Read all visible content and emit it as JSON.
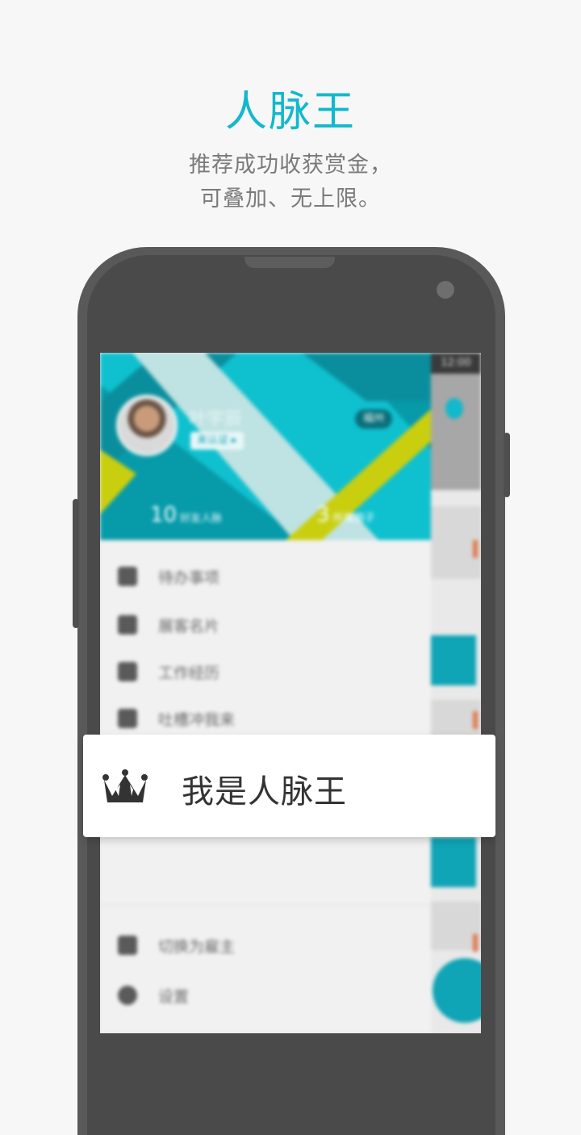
{
  "promo": {
    "title": "人脉王",
    "subtitle_line1": "推荐成功收获赏金，",
    "subtitle_line2": "可叠加、无上限。"
  },
  "app_screen": {
    "status_time": "12:00",
    "profile": {
      "name": "叶宇辰",
      "cert_label": "未认证 ▸",
      "location": "福州",
      "stat1_num": "10",
      "stat1_label": "好友人脉",
      "stat2_num": "3",
      "stat2_label": "所属圈子"
    },
    "menu": [
      {
        "label": "待办事项",
        "icon": "calendar-icon"
      },
      {
        "label": "展客名片",
        "icon": "contact-card-icon"
      },
      {
        "label": "工作经历",
        "icon": "briefcase-icon"
      },
      {
        "label": "吐槽冲我来",
        "icon": "feedback-icon"
      }
    ],
    "bottom_menu": [
      {
        "label": "切换为雇主",
        "icon": "switch-icon"
      },
      {
        "label": "设置",
        "icon": "gear-icon"
      }
    ]
  },
  "highlight": {
    "label": "我是人脉王",
    "icon": "crown-icon"
  },
  "colors": {
    "accent": "#12b8cc",
    "teal_dark": "#079aa9",
    "yellow_green": "#c9cf0f",
    "background": "#f7f7f7"
  }
}
